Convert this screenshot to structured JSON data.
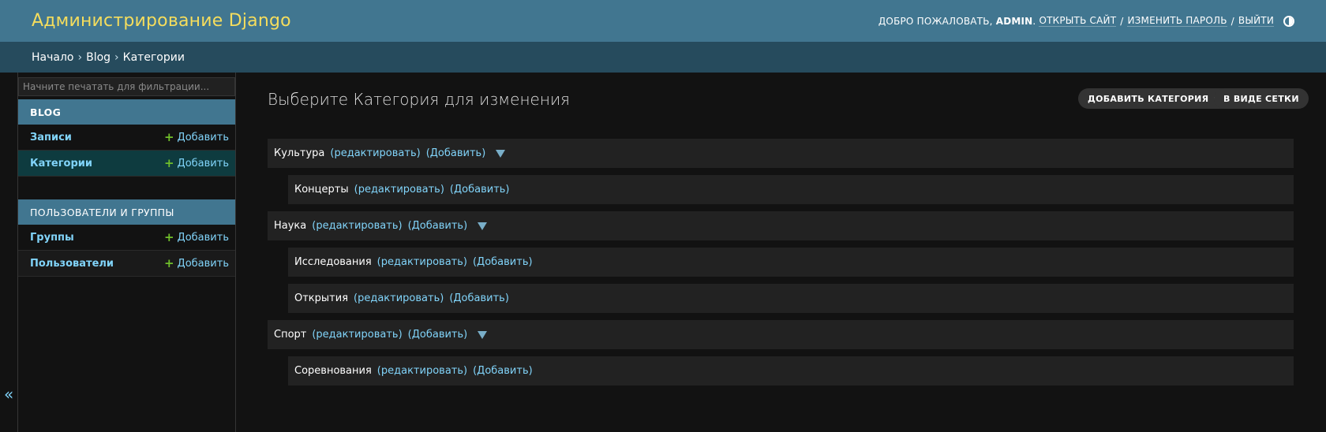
{
  "header": {
    "branding": "Администрирование Django",
    "welcome": "ДОБРО ПОЖАЛОВАТЬ,",
    "username": "ADMIN",
    "username_suffix": ".",
    "view_site": "ОТКРЫТЬ САЙТ",
    "change_password": "ИЗМЕНИТЬ ПАРОЛЬ",
    "logout": "ВЫЙТИ",
    "separator": "/",
    "theme_toggle_icon": "half-circle-icon"
  },
  "breadcrumbs": {
    "home": "Начало",
    "app": "Blog",
    "current": "Категории",
    "separator": "›"
  },
  "sidebar": {
    "filter_placeholder": "Начните печатать для фильтрации...",
    "modules": [
      {
        "caption": "BLOG",
        "models": [
          {
            "name": "Записи",
            "add_label": "Добавить",
            "plus": "+"
          },
          {
            "name": "Категории",
            "add_label": "Добавить",
            "plus": "+"
          }
        ]
      },
      {
        "caption": "ПОЛЬЗОВАТЕЛИ И ГРУППЫ",
        "models": [
          {
            "name": "Группы",
            "add_label": "Добавить",
            "plus": "+"
          },
          {
            "name": "Пользователи",
            "add_label": "Добавить",
            "plus": "+"
          }
        ]
      }
    ],
    "collapse_label": "«"
  },
  "content": {
    "title": "Выберите Категория для изменения",
    "add_button": "ДОБАВИТЬ КАТЕГОРИЯ",
    "add_button_plus": "✚",
    "grid_button": "В ВИДЕ СЕТКИ",
    "tree": [
      {
        "name": "Культура",
        "edit": "(редактировать)",
        "add": "(Добавить)",
        "level": 0,
        "has_children": true
      },
      {
        "name": "Концерты",
        "edit": "(редактировать)",
        "add": "(Добавить)",
        "level": 1,
        "has_children": false
      },
      {
        "name": "Наука",
        "edit": "(редактировать)",
        "add": "(Добавить)",
        "level": 0,
        "has_children": true
      },
      {
        "name": "Исследования",
        "edit": "(редактировать)",
        "add": "(Добавить)",
        "level": 1,
        "has_children": false
      },
      {
        "name": "Открытия",
        "edit": "(редактировать)",
        "add": "(Добавить)",
        "level": 1,
        "has_children": false
      },
      {
        "name": "Спорт",
        "edit": "(редактировать)",
        "add": "(Добавить)",
        "level": 0,
        "has_children": true
      },
      {
        "name": "Соревнования",
        "edit": "(редактировать)",
        "add": "(Добавить)",
        "level": 1,
        "has_children": false
      }
    ]
  },
  "colors": {
    "header_bg": "#417690",
    "breadcrumbs_bg": "#264b5d",
    "branding": "#f5dd5d",
    "link": "#81d4fa",
    "add_plus": "#70bf2b",
    "active_row": "#0e3b3f",
    "page_bg": "#121212",
    "tree_row_bg": "#222222"
  }
}
